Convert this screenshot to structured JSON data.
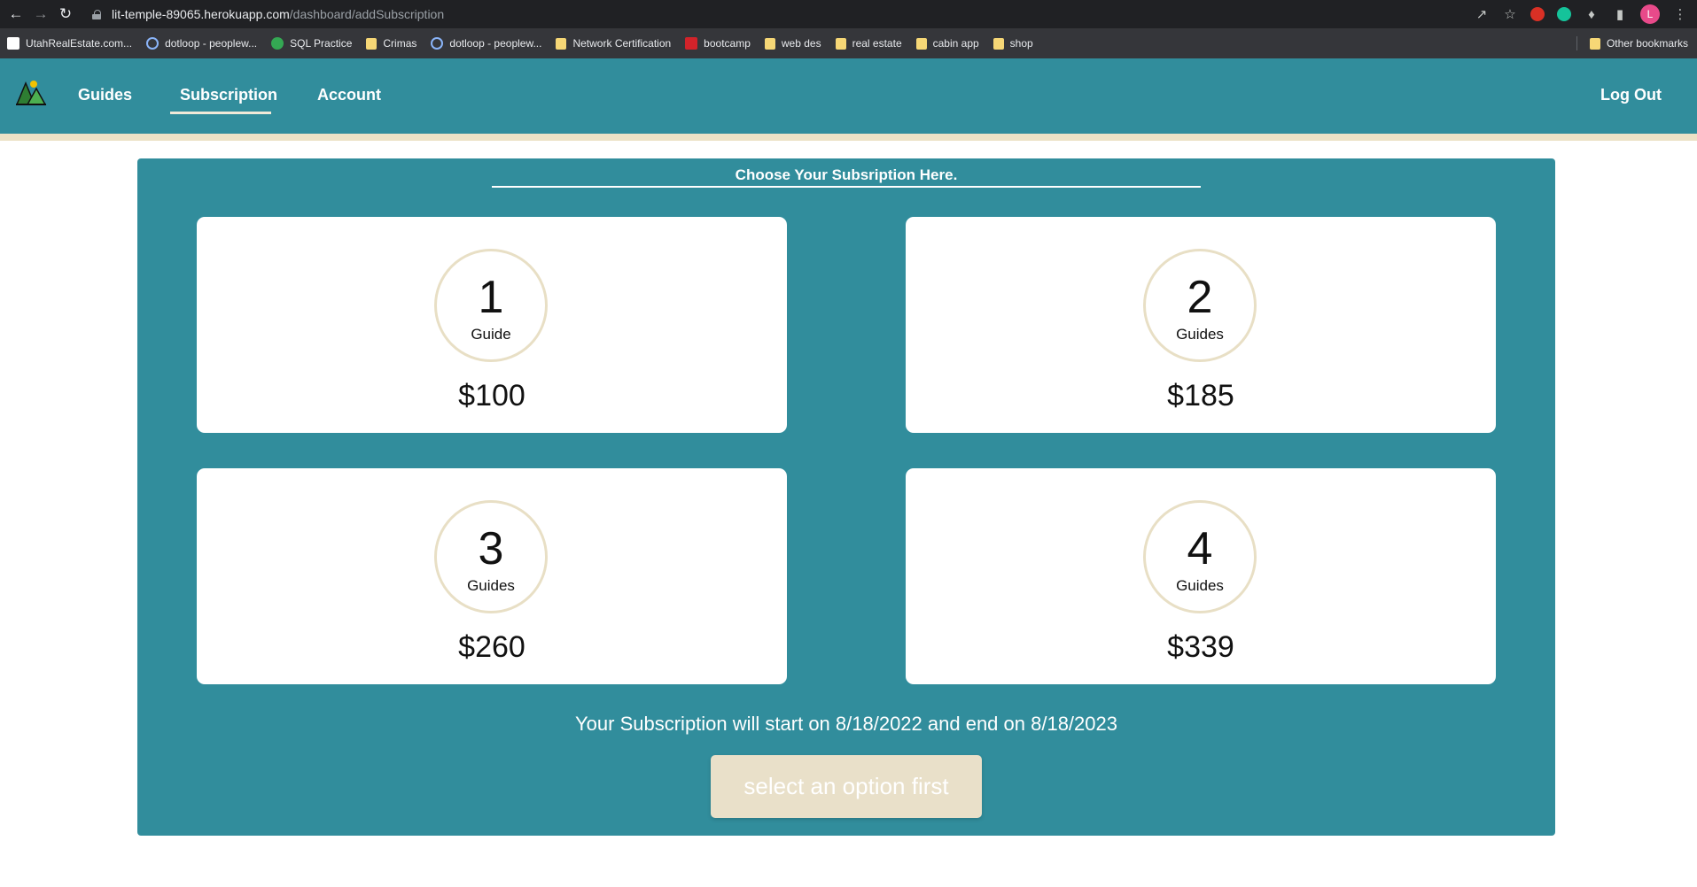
{
  "browser": {
    "url_host": "lit-temple-89065.herokuapp.com",
    "url_path": "/dashboard/addSubscription",
    "profile_initial": "L",
    "bookmarks": [
      {
        "label": "UtahRealEstate.com...",
        "icon": "site"
      },
      {
        "label": "dotloop - peoplew...",
        "icon": "blue"
      },
      {
        "label": "SQL Practice",
        "icon": "green"
      },
      {
        "label": "Crimas",
        "icon": "folder"
      },
      {
        "label": "dotloop - peoplew...",
        "icon": "blue"
      },
      {
        "label": "Network Certification",
        "icon": "folder"
      },
      {
        "label": "bootcamp",
        "icon": "red"
      },
      {
        "label": "web des",
        "icon": "folder"
      },
      {
        "label": "real estate",
        "icon": "folder"
      },
      {
        "label": "cabin app",
        "icon": "folder"
      },
      {
        "label": "shop",
        "icon": "folder"
      }
    ],
    "other_bookmarks": "Other bookmarks"
  },
  "nav": {
    "guides": "Guides",
    "subscription": "Subscription",
    "account": "Account",
    "logout": "Log Out",
    "active": "Subscription"
  },
  "main": {
    "title": "Choose Your Subsription Here.",
    "options": [
      {
        "count": "1",
        "unit": "Guide",
        "price": "$100"
      },
      {
        "count": "2",
        "unit": "Guides",
        "price": "$185"
      },
      {
        "count": "3",
        "unit": "Guides",
        "price": "$260"
      },
      {
        "count": "4",
        "unit": "Guides",
        "price": "$339"
      }
    ],
    "dates_text": "Your Subscription will start on 8/18/2022 and end on 8/18/2023",
    "button_label": "select an option first"
  },
  "colors": {
    "brand_teal": "#318d9c",
    "accent_cream": "#e9e0c9"
  }
}
